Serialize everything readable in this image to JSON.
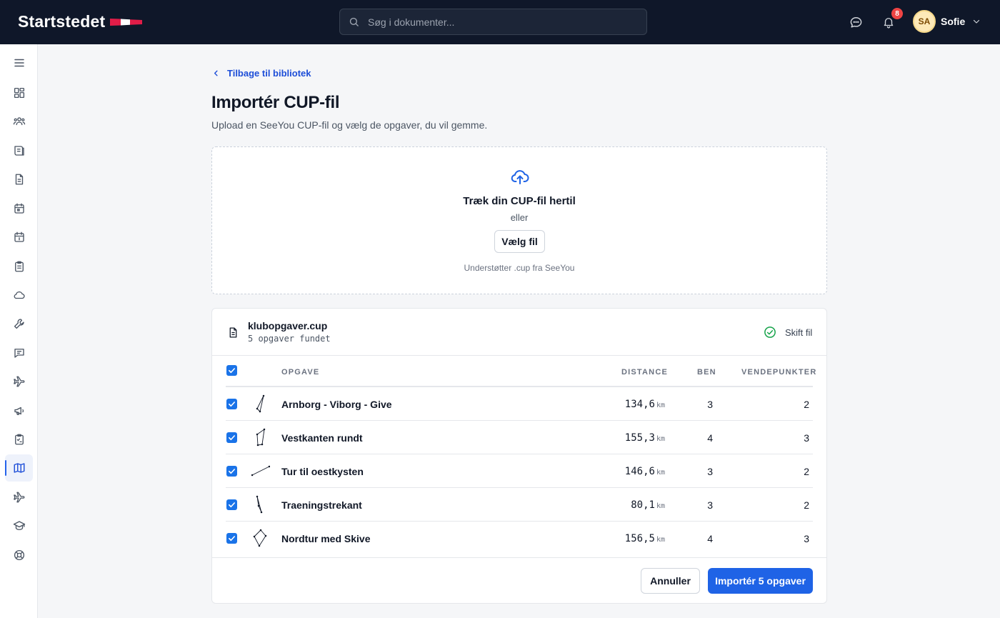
{
  "app": {
    "logo_text": "Startstedet",
    "search_placeholder": "Søg i dokumenter...",
    "notifications_count": "8",
    "user": {
      "initials": "SA",
      "name": "Sofie"
    }
  },
  "sidebar": {
    "items": [
      {
        "icon": "menu-icon"
      },
      {
        "icon": "dashboard-icon"
      },
      {
        "icon": "members-icon"
      },
      {
        "icon": "book-icon"
      },
      {
        "icon": "document-icon"
      },
      {
        "icon": "calendar-icon"
      },
      {
        "icon": "calendar-day-icon"
      },
      {
        "icon": "clipboard-icon"
      },
      {
        "icon": "cloud-icon"
      },
      {
        "icon": "wrench-icon"
      },
      {
        "icon": "chat-icon"
      },
      {
        "icon": "plane-icon"
      },
      {
        "icon": "megaphone-icon"
      },
      {
        "icon": "checklist-icon"
      },
      {
        "icon": "map-icon",
        "active": true
      },
      {
        "icon": "plane-alt-icon"
      },
      {
        "icon": "graduation-icon"
      },
      {
        "icon": "lifebuoy-icon"
      }
    ]
  },
  "page": {
    "back_label": "Tilbage til bibliotek",
    "title": "Importér CUP-fil",
    "subtitle": "Upload en SeeYou CUP-fil og vælg de opgaver, du vil gemme."
  },
  "dropzone": {
    "title": "Træk din CUP-fil hertil",
    "or": "eller",
    "button": "Vælg fil",
    "hint": "Understøtter .cup fra SeeYou"
  },
  "file": {
    "name": "klubopgaver.cup",
    "count": "5 opgaver fundet",
    "switch_label": "Skift fil"
  },
  "table": {
    "headers": {
      "task": "OPGAVE",
      "distance": "DISTANCE",
      "legs": "BEN",
      "turnpoints": "VENDEPUNKTER"
    },
    "unit": "km",
    "rows": [
      {
        "name": "Arnborg - Viborg - Give",
        "distance": "134,6",
        "legs": "3",
        "turnpoints": "2",
        "checked": true
      },
      {
        "name": "Vestkanten rundt",
        "distance": "155,3",
        "legs": "4",
        "turnpoints": "3",
        "checked": true
      },
      {
        "name": "Tur til oestkysten",
        "distance": "146,6",
        "legs": "3",
        "turnpoints": "2",
        "checked": true
      },
      {
        "name": "Traeningstrekant",
        "distance": "80,1",
        "legs": "3",
        "turnpoints": "2",
        "checked": true
      },
      {
        "name": "Nordtur med Skive",
        "distance": "156,5",
        "legs": "4",
        "turnpoints": "3",
        "checked": true
      }
    ]
  },
  "actions": {
    "cancel": "Annuller",
    "import": "Importér 5 opgaver"
  },
  "colors": {
    "topbar": "#0f1729",
    "primary": "#1f63e6",
    "checkbox": "#1a73e8",
    "success": "#16a34a",
    "badge": "#ef4444"
  }
}
